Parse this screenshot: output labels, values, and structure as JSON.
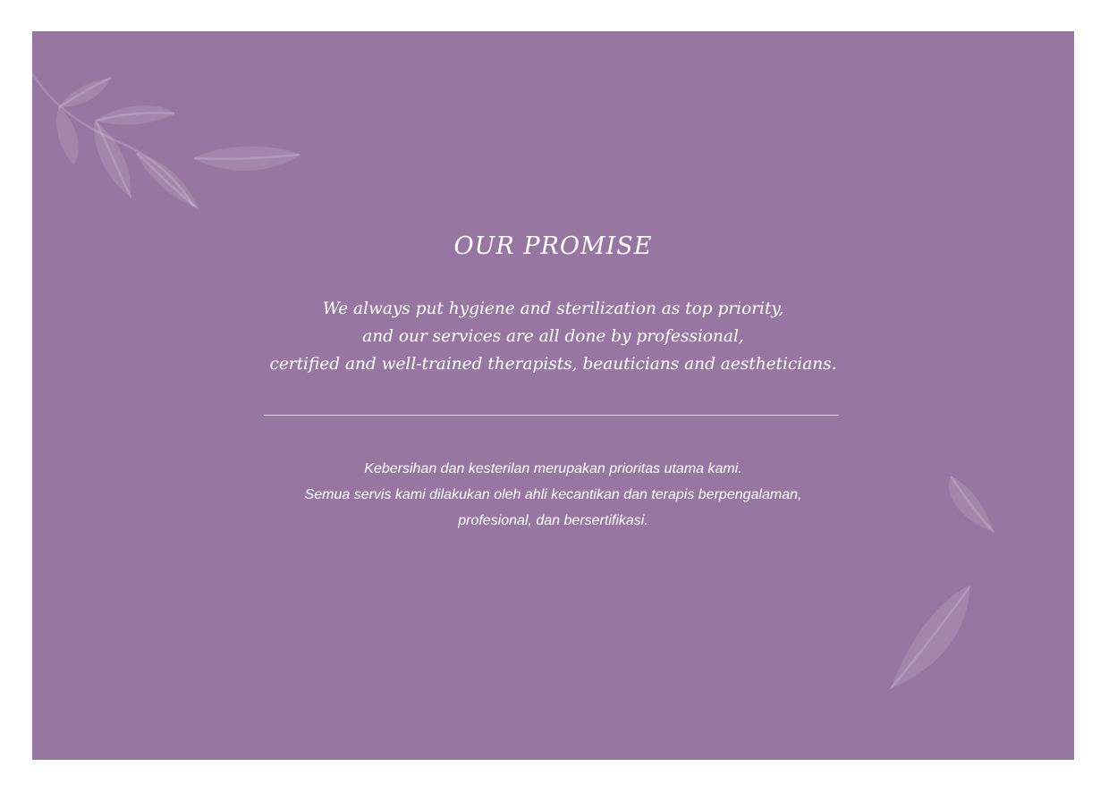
{
  "colors": {
    "page_background": "#ffffff",
    "panel_background": "#9876a2",
    "text": "#ffffff"
  },
  "heading": {
    "title": "OUR PROMISE"
  },
  "promise_en": {
    "lines": [
      "We always put hygiene and sterilization as top priority,",
      "and our services are all done by professional,",
      "certified and well-trained therapists, beauticians and aestheticians."
    ]
  },
  "promise_id": {
    "lines": [
      "Kebersihan dan kesterilan merupakan prioritas utama kami.",
      "Semua servis kami dilakukan oleh ahli kecantikan dan terapis berpengalaman,",
      "profesional, dan bersertifikasi."
    ]
  },
  "icons": {
    "top_left": "leaf-branch-icon",
    "right_middle": "leaf-icon",
    "bottom_right": "leaf-icon"
  }
}
